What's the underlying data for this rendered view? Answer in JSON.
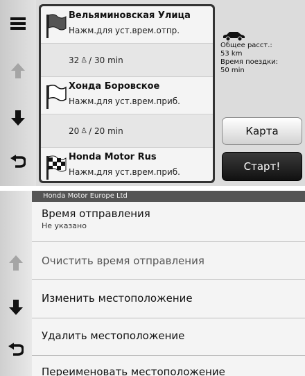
{
  "route_screen": {
    "waypoints": [
      {
        "name": "Вельяминовская Улица",
        "action": "Нажм.для уст.врем.отпр.",
        "flag": "waypoint-flag-icon"
      },
      {
        "name": "Хонда Боровское",
        "action": "Нажм.для уст.врем.приб.",
        "flag": "waypoint-flag-icon"
      },
      {
        "name": "Honda Motor Rus",
        "action": "Нажм.для уст.врем.приб.",
        "flag": "checkered-flag-icon"
      }
    ],
    "segments": [
      {
        "distance": "32",
        "unit_icon": "walk-icon",
        "time": "/ 30 min"
      },
      {
        "distance": "20",
        "unit_icon": "walk-icon",
        "time": "/ 20 min"
      }
    ],
    "summary": {
      "distance_label": "Общее расст.:",
      "distance_value": "53 km",
      "time_label": "Время поездки:",
      "time_value": "50 min"
    },
    "map_button": "Карта",
    "start_button": "Старт!"
  },
  "options_screen": {
    "title": "Honda Motor Europe Ltd",
    "items": [
      {
        "label": "Время отправления",
        "sub": "Не указано"
      },
      {
        "label": "Очистить время отправления"
      },
      {
        "label": "Изменить местоположение"
      },
      {
        "label": "Удалить местоположение"
      },
      {
        "label": "Переименовать местоположение"
      }
    ]
  },
  "colors": {
    "accent_dark": "#111111",
    "panel_bg": "#dcdcdc",
    "title_bar": "#555555"
  }
}
